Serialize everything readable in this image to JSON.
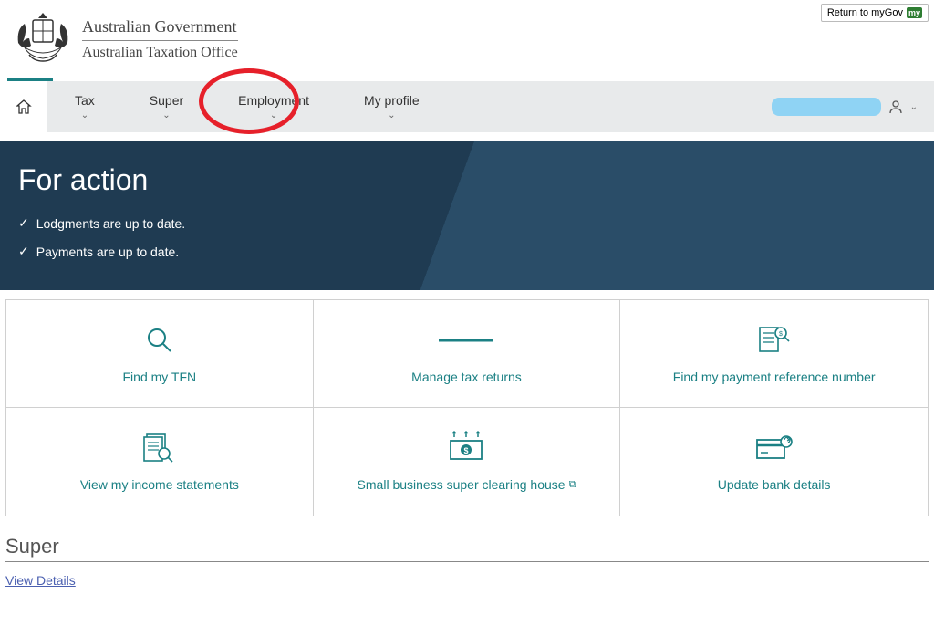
{
  "header": {
    "gov_line1": "Australian Government",
    "gov_line2": "Australian Taxation Office",
    "return_label": "Return to myGov",
    "mygov_badge": "my"
  },
  "nav": {
    "items": [
      "Tax",
      "Super",
      "Employment",
      "My profile"
    ]
  },
  "banner": {
    "title": "For action",
    "status1": "Lodgments are up to date.",
    "status2": "Payments are up to date."
  },
  "tiles": [
    {
      "label": "Find my TFN"
    },
    {
      "label": "Manage tax returns"
    },
    {
      "label": "Find my payment reference number"
    },
    {
      "label": "View my income statements"
    },
    {
      "label": "Small business super clearing house",
      "external": true
    },
    {
      "label": "Update bank details"
    }
  ],
  "section": {
    "super_heading": "Super",
    "view_details": "View Details"
  }
}
